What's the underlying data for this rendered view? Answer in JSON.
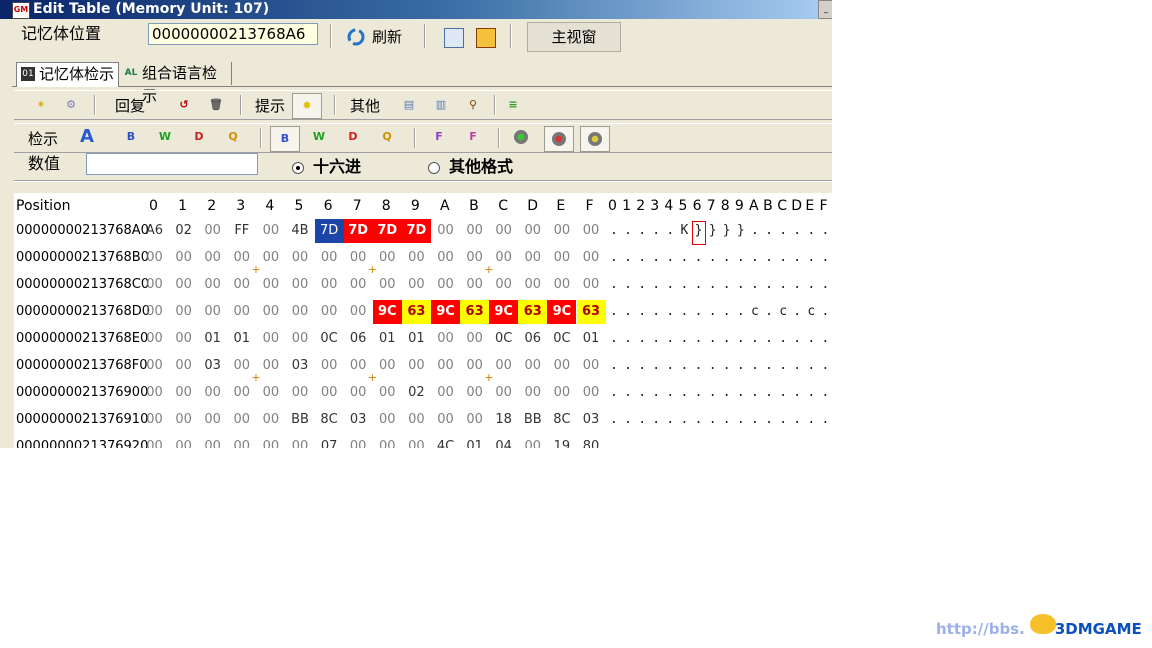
{
  "window": {
    "title": "Edit Table (Memory Unit: 107)"
  },
  "address": {
    "label": "记忆体位置",
    "value": "00000000213768A6"
  },
  "toolbar1": {
    "refresh": "刷新",
    "main_window": "主视窗"
  },
  "tabs": [
    {
      "label": "记忆体检示"
    },
    {
      "label": "组合语言检示"
    }
  ],
  "toolbar2": {
    "revert": "回复",
    "hint": "提示",
    "other": "其他"
  },
  "toolbar3": {
    "search": "检示"
  },
  "value_row": {
    "label": "数值",
    "value": "",
    "hex_option": "十六进",
    "other_option": "其他格式"
  },
  "hex": {
    "header_position": "Position",
    "columns": [
      "0",
      "1",
      "2",
      "3",
      "4",
      "5",
      "6",
      "7",
      "8",
      "9",
      "A",
      "B",
      "C",
      "D",
      "E",
      "F"
    ],
    "ascii_header": [
      "0",
      "1",
      "2",
      "3",
      "4",
      "5",
      "6",
      "7",
      "8",
      "9",
      "A",
      "B",
      "C",
      "D",
      "E",
      "F"
    ],
    "rows": [
      {
        "pos": "00000000213768A0",
        "bytes": [
          "A6",
          "02",
          "00",
          "FF",
          "00",
          "4B",
          "7D",
          "7D",
          "7D",
          "7D",
          "00",
          "00",
          "00",
          "00",
          "00",
          "00"
        ],
        "ascii": [
          ".",
          ".",
          ".",
          ".",
          ".",
          "K",
          "}",
          "}",
          "}",
          "}",
          ".",
          ".",
          ".",
          ".",
          ".",
          "."
        ]
      },
      {
        "pos": "00000000213768B0",
        "bytes": [
          "00",
          "00",
          "00",
          "00",
          "00",
          "00",
          "00",
          "00",
          "00",
          "00",
          "00",
          "00",
          "00",
          "00",
          "00",
          "00"
        ],
        "ascii": [
          ".",
          ".",
          ".",
          ".",
          ".",
          ".",
          ".",
          ".",
          ".",
          ".",
          ".",
          ".",
          ".",
          ".",
          ".",
          "."
        ]
      },
      {
        "pos": "00000000213768C0",
        "bytes": [
          "00",
          "00",
          "00",
          "00",
          "00",
          "00",
          "00",
          "00",
          "00",
          "00",
          "00",
          "00",
          "00",
          "00",
          "00",
          "00"
        ],
        "ascii": [
          ".",
          ".",
          ".",
          ".",
          ".",
          ".",
          ".",
          ".",
          ".",
          ".",
          ".",
          ".",
          ".",
          ".",
          ".",
          "."
        ]
      },
      {
        "pos": "00000000213768D0",
        "bytes": [
          "00",
          "00",
          "00",
          "00",
          "00",
          "00",
          "00",
          "00",
          "9C",
          "63",
          "9C",
          "63",
          "9C",
          "63",
          "9C",
          "63"
        ],
        "ascii": [
          ".",
          ".",
          ".",
          ".",
          ".",
          ".",
          ".",
          ".",
          ".",
          ".",
          "c",
          ".",
          "c",
          ".",
          "c",
          ".",
          "c"
        ]
      },
      {
        "pos": "00000000213768E0",
        "bytes": [
          "00",
          "00",
          "01",
          "01",
          "00",
          "00",
          "0C",
          "06",
          "01",
          "01",
          "00",
          "00",
          "0C",
          "06",
          "0C",
          "01"
        ],
        "ascii": [
          ".",
          ".",
          ".",
          ".",
          ".",
          ".",
          ".",
          ".",
          ".",
          ".",
          ".",
          ".",
          ".",
          ".",
          ".",
          "."
        ]
      },
      {
        "pos": "00000000213768F0",
        "bytes": [
          "00",
          "00",
          "03",
          "00",
          "00",
          "03",
          "00",
          "00",
          "00",
          "00",
          "00",
          "00",
          "00",
          "00",
          "00",
          "00"
        ],
        "ascii": [
          ".",
          ".",
          ".",
          ".",
          ".",
          ".",
          ".",
          ".",
          ".",
          ".",
          ".",
          ".",
          ".",
          ".",
          ".",
          "."
        ]
      },
      {
        "pos": "0000000021376900",
        "bytes": [
          "00",
          "00",
          "00",
          "00",
          "00",
          "00",
          "00",
          "00",
          "00",
          "02",
          "00",
          "00",
          "00",
          "00",
          "00",
          "00"
        ],
        "ascii": [
          ".",
          ".",
          ".",
          ".",
          ".",
          ".",
          ".",
          ".",
          ".",
          ".",
          ".",
          ".",
          ".",
          ".",
          ".",
          "."
        ]
      },
      {
        "pos": "0000000021376910",
        "bytes": [
          "00",
          "00",
          "00",
          "00",
          "00",
          "BB",
          "8C",
          "03",
          "00",
          "00",
          "00",
          "00",
          "18",
          "BB",
          "8C",
          "03"
        ],
        "ascii": [
          ".",
          ".",
          ".",
          ".",
          ".",
          ".",
          ".",
          ".",
          ".",
          ".",
          ".",
          ".",
          ".",
          ".",
          ".",
          "."
        ]
      },
      {
        "pos": "0000000021376920",
        "bytes": [
          "00",
          "00",
          "00",
          "00",
          "00",
          "00",
          "07",
          "00",
          "00",
          "00",
          "4C",
          "01",
          "04",
          "00",
          "19",
          "80"
        ],
        "ascii": [
          ".",
          ".",
          ".",
          ".",
          ".",
          ".",
          ".",
          ".",
          ".",
          ".",
          ".",
          ".",
          ".",
          ".",
          ".",
          "."
        ]
      }
    ]
  },
  "watermark": {
    "url": "http://bbs.",
    "brand": "3DMGAME"
  }
}
